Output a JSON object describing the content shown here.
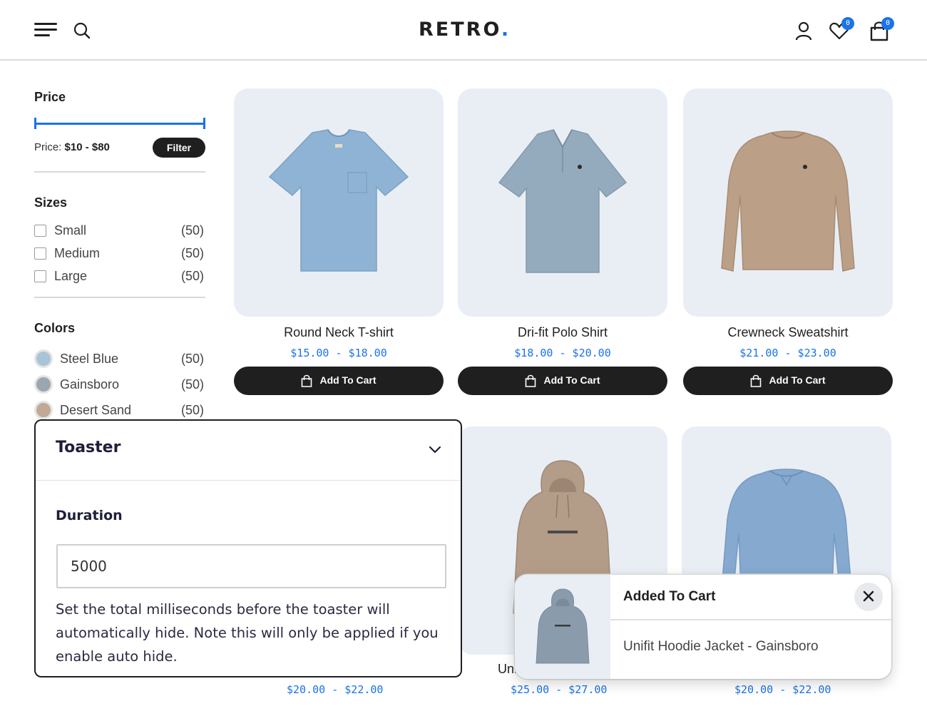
{
  "header": {
    "logo_text": "RETRO",
    "logo_dot": ".",
    "wishlist_count": "0",
    "cart_count": "0"
  },
  "filters": {
    "price": {
      "title": "Price",
      "label": "Price:",
      "range_text": "$10 - $80",
      "filter_button": "Filter"
    },
    "sizes": {
      "title": "Sizes",
      "items": [
        {
          "label": "Small",
          "count": "(50)"
        },
        {
          "label": "Medium",
          "count": "(50)"
        },
        {
          "label": "Large",
          "count": "(50)"
        }
      ]
    },
    "colors": {
      "title": "Colors",
      "items": [
        {
          "label": "Steel Blue",
          "count": "(50)",
          "color": "#a9c4d6"
        },
        {
          "label": "Gainsboro",
          "count": "(50)",
          "color": "#9aa7b0"
        },
        {
          "label": "Desert Sand",
          "count": "(50)",
          "color": "#c2a996"
        }
      ]
    }
  },
  "products": [
    {
      "name": "Round Neck T-shirt",
      "price": "$15.00 - $18.00",
      "button": "Add To Cart",
      "icon": "tshirt-image",
      "color": "#8fb3d4"
    },
    {
      "name": "Dri-fit Polo Shirt",
      "price": "$18.00 - $20.00",
      "button": "Add To Cart",
      "icon": "polo-image",
      "color": "#94abbd"
    },
    {
      "name": "Crewneck Sweatshirt",
      "price": "$21.00 - $23.00",
      "button": "Add To Cart",
      "icon": "sweatshirt-image",
      "color": "#bb9f86"
    },
    {
      "name": "",
      "price": "$20.00 - $22.00",
      "icon": "product-image",
      "color": "#e9eef5"
    },
    {
      "name": "Uni",
      "price": "$25.00 - $27.00",
      "icon": "hoodie-image",
      "color": "#b39c88"
    },
    {
      "name": "",
      "price": "$20.00 - $22.00",
      "icon": "sweatshirt-image",
      "color": "#86a9cf"
    }
  ],
  "toaster_panel": {
    "title": "Toaster",
    "duration_label": "Duration",
    "duration_value": "5000",
    "help_text": "Set the total milliseconds before the toaster will automatically hide. Note this will only be applied if you enable auto hide."
  },
  "toast": {
    "title": "Added To Cart",
    "message": "Unifit Hoodie Jacket - Gainsboro",
    "image_color": "#8a9bac"
  },
  "colors": {
    "accent": "#1a73e8",
    "dark": "#1f1f1f",
    "card_bg": "#e9eef5"
  }
}
